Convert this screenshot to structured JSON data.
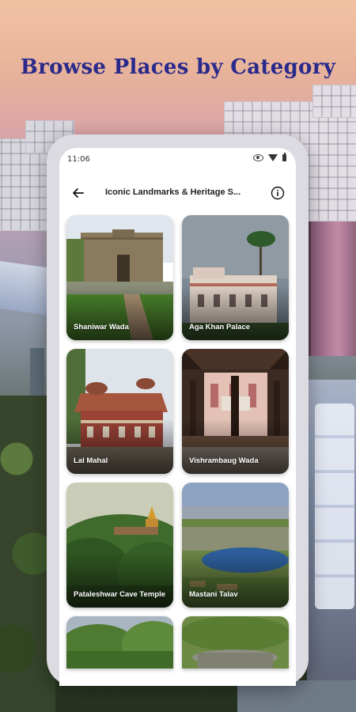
{
  "headline": "Browse Places by Category",
  "status_bar": {
    "time": "11:06"
  },
  "app_bar": {
    "title": "Iconic Landmarks & Heritage S..."
  },
  "places": [
    {
      "name": "Shaniwar Wada"
    },
    {
      "name": "Aga Khan Palace"
    },
    {
      "name": "Lal Mahal"
    },
    {
      "name": "Vishrambaug Wada"
    },
    {
      "name": "Pataleshwar Cave Temple"
    },
    {
      "name": "Mastani Talav"
    },
    {
      "name": ""
    },
    {
      "name": ""
    }
  ],
  "colors": {
    "headline": "#2a2a8c",
    "screen_bg": "#ffffff",
    "phone_frame": "#dcdbe1"
  }
}
